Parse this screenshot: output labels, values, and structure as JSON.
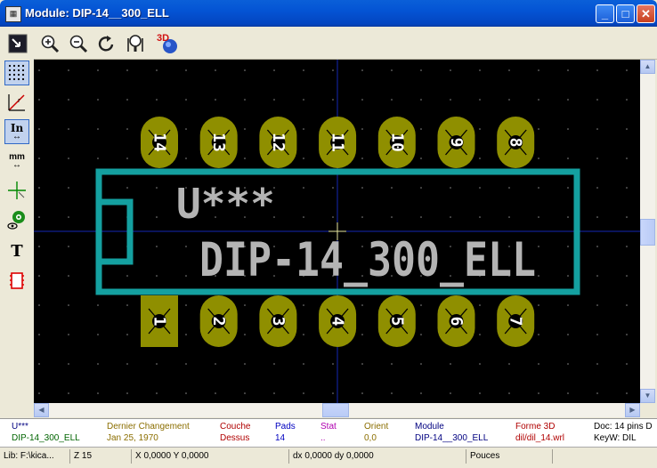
{
  "window": {
    "title": "Module: DIP-14__300_ELL",
    "minimize": "_",
    "maximize": "□",
    "close": "✕"
  },
  "toolbar": {
    "icon_3d": "3D"
  },
  "left_toolbar": {
    "units_in": "In",
    "units_mm": "mm",
    "text_tool": "T"
  },
  "module": {
    "reference": "U***",
    "value": "DIP-14_300_ELL",
    "pads_top": [
      "14",
      "13",
      "12",
      "11",
      "10",
      "9",
      "8"
    ],
    "pads_bottom": [
      "1",
      "2",
      "3",
      "4",
      "5",
      "6",
      "7"
    ]
  },
  "colors": {
    "pad": "#8f8f00",
    "silkscreen": "#14a0a0",
    "text": "#b4b4b4",
    "axis": "#1428b4",
    "cursor": "#e6e6a0"
  },
  "info": {
    "ref_label": "U***",
    "ref_value": "DIP-14_300_ELL",
    "lastchange_label": "Dernier Changement",
    "lastchange_value": "Jan 25, 1970",
    "layer_label": "Couche",
    "layer_value": "Dessus",
    "pads_label": "Pads",
    "pads_value": "14",
    "stat_label": "Stat",
    "stat_value": "..",
    "orient_label": "Orient",
    "orient_value": "0,0",
    "module_label": "Module",
    "module_value": "DIP-14__300_ELL",
    "shape3d_label": "Forme 3D",
    "shape3d_value": "dil/dil_14.wrl",
    "doc_label": "Doc: 14 pins D",
    "keyw_label": "KeyW: DIL"
  },
  "status": {
    "lib": "Lib: F:\\kica...",
    "zoom": "Z 15",
    "xy": "X 0,0000  Y 0,0000",
    "dxdy": "dx 0,0000  dy 0,0000",
    "units": "Pouces"
  }
}
